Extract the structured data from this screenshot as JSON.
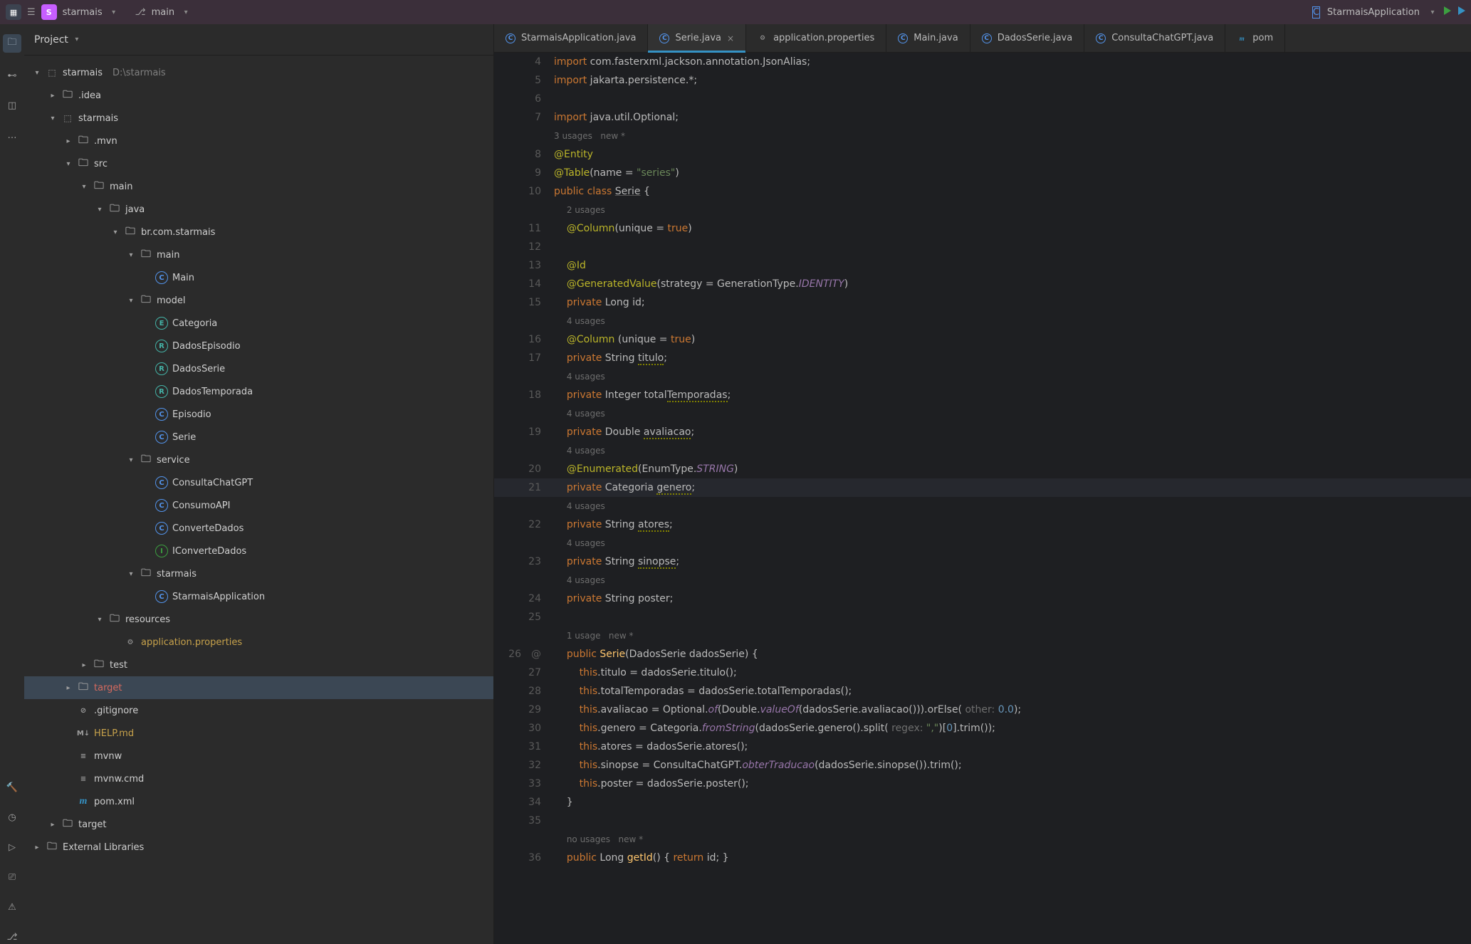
{
  "topbar": {
    "project_initial": "S",
    "project_name": "starmais",
    "branch": "main",
    "run_config": "StarmaisApplication"
  },
  "project_panel": {
    "title": "Project"
  },
  "tree": [
    {
      "d": 0,
      "c": "exp",
      "i": "mod",
      "l": "starmais",
      "suffix": "D:\\starmais"
    },
    {
      "d": 1,
      "c": "col",
      "i": "folder",
      "l": ".idea"
    },
    {
      "d": 1,
      "c": "exp",
      "i": "mod",
      "l": "starmais"
    },
    {
      "d": 2,
      "c": "col",
      "i": "folder",
      "l": ".mvn"
    },
    {
      "d": 2,
      "c": "exp",
      "i": "folder",
      "l": "src"
    },
    {
      "d": 3,
      "c": "exp",
      "i": "folder",
      "l": "main"
    },
    {
      "d": 4,
      "c": "exp",
      "i": "folder",
      "l": "java"
    },
    {
      "d": 5,
      "c": "exp",
      "i": "folder",
      "l": "br.com.starmais"
    },
    {
      "d": 6,
      "c": "exp",
      "i": "folder",
      "l": "main"
    },
    {
      "d": 7,
      "c": "none",
      "i": "c-blue",
      "ich": "C",
      "l": "Main"
    },
    {
      "d": 6,
      "c": "exp",
      "i": "folder",
      "l": "model"
    },
    {
      "d": 7,
      "c": "none",
      "i": "c-teal",
      "ich": "E",
      "l": "Categoria"
    },
    {
      "d": 7,
      "c": "none",
      "i": "c-teal",
      "ich": "R",
      "l": "DadosEpisodio"
    },
    {
      "d": 7,
      "c": "none",
      "i": "c-teal",
      "ich": "R",
      "l": "DadosSerie"
    },
    {
      "d": 7,
      "c": "none",
      "i": "c-teal",
      "ich": "R",
      "l": "DadosTemporada"
    },
    {
      "d": 7,
      "c": "none",
      "i": "c-blue",
      "ich": "C",
      "l": "Episodio"
    },
    {
      "d": 7,
      "c": "none",
      "i": "c-blue",
      "ich": "C",
      "l": "Serie"
    },
    {
      "d": 6,
      "c": "exp",
      "i": "folder",
      "l": "service"
    },
    {
      "d": 7,
      "c": "none",
      "i": "c-blue",
      "ich": "C",
      "l": "ConsultaChatGPT"
    },
    {
      "d": 7,
      "c": "none",
      "i": "c-blue",
      "ich": "C",
      "l": "ConsumoAPI"
    },
    {
      "d": 7,
      "c": "none",
      "i": "c-blue",
      "ich": "C",
      "l": "ConverteDados"
    },
    {
      "d": 7,
      "c": "none",
      "i": "c-green",
      "ich": "I",
      "l": "IConverteDados"
    },
    {
      "d": 6,
      "c": "exp",
      "i": "folder",
      "l": "starmais"
    },
    {
      "d": 7,
      "c": "none",
      "i": "c-blue",
      "ich": "C",
      "l": "StarmaisApplication"
    },
    {
      "d": 4,
      "c": "exp",
      "i": "folder",
      "l": "resources"
    },
    {
      "d": 5,
      "c": "none",
      "i": "plain",
      "ich": "⚙",
      "l": "application.properties",
      "cls": "yel"
    },
    {
      "d": 3,
      "c": "col",
      "i": "folder",
      "l": "test"
    },
    {
      "d": 2,
      "c": "col",
      "i": "folder",
      "l": "target",
      "cls": "red",
      "sel": true
    },
    {
      "d": 2,
      "c": "none",
      "i": "plain",
      "ich": "⊘",
      "l": ".gitignore"
    },
    {
      "d": 2,
      "c": "none",
      "i": "plain",
      "ich": "M↓",
      "l": "HELP.md",
      "cls": "yel"
    },
    {
      "d": 2,
      "c": "none",
      "i": "plain",
      "ich": "≡",
      "l": "mvnw"
    },
    {
      "d": 2,
      "c": "none",
      "i": "plain",
      "ich": "≡",
      "l": "mvnw.cmd"
    },
    {
      "d": 2,
      "c": "none",
      "i": "plain",
      "ich": "m",
      "l": "pom.xml",
      "icl": "m"
    },
    {
      "d": 1,
      "c": "col",
      "i": "folder",
      "l": "target"
    },
    {
      "d": 0,
      "c": "col",
      "i": "folder",
      "l": "External Libraries"
    }
  ],
  "tabs": [
    {
      "icon": "c",
      "label": "StarmaisApplication.java"
    },
    {
      "icon": "c",
      "label": "Serie.java",
      "active": true,
      "close": true
    },
    {
      "icon": "g",
      "label": "application.properties"
    },
    {
      "icon": "c",
      "label": "Main.java"
    },
    {
      "icon": "c",
      "label": "DadosSerie.java"
    },
    {
      "icon": "c",
      "label": "ConsultaChatGPT.java"
    },
    {
      "icon": "m",
      "label": "pom"
    }
  ],
  "code": [
    {
      "a": "",
      "b": "4",
      "h": "<span class='kw'>import</span> com.fasterxml.jackson.annotation.JsonAlias;"
    },
    {
      "a": "",
      "b": "5",
      "h": "<span class='kw'>import</span> jakarta.persistence.*;"
    },
    {
      "a": "",
      "b": "6",
      "h": ""
    },
    {
      "a": "",
      "b": "7",
      "h": "<span class='kw'>import</span> java.util.Optional;"
    },
    {
      "a": "",
      "b": "",
      "h": "<span class='com-hint'>3 usages   new *</span>"
    },
    {
      "a": "",
      "b": "8",
      "h": "<span class='ann'>@Entity</span>"
    },
    {
      "a": "",
      "b": "9",
      "h": "<span class='ann'>@Table</span>(name = <span class='str'>\"series\"</span>)"
    },
    {
      "a": "",
      "b": "10",
      "h": "<span class='kw'>public class</span> <span class='und'>Serie</span> {"
    },
    {
      "a": "",
      "b": "",
      "h": "    <span class='com-hint'>2 usages</span>"
    },
    {
      "a": "",
      "b": "11",
      "h": "    <span class='ann'>@Column</span>(unique = <span class='kw'>true</span>)"
    },
    {
      "a": "",
      "b": "12",
      "h": ""
    },
    {
      "a": "",
      "b": "13",
      "h": "    <span class='ann'>@Id</span>"
    },
    {
      "a": "",
      "b": "14",
      "h": "    <span class='ann'>@GeneratedValue</span>(strategy = GenerationType.<span class='fld'>IDENTITY</span>)"
    },
    {
      "a": "",
      "b": "15",
      "h": "    <span class='kw'>private</span> Long id;"
    },
    {
      "a": "",
      "b": "",
      "h": "    <span class='com-hint'>4 usages</span>"
    },
    {
      "a": "",
      "b": "16",
      "h": "    <span class='ann'>@Column</span> (unique = <span class='kw'>true</span>)"
    },
    {
      "a": "",
      "b": "17",
      "h": "    <span class='kw'>private</span> String <span class='und-warn'>titulo</span>;"
    },
    {
      "a": "",
      "b": "",
      "h": "    <span class='com-hint'>4 usages</span>"
    },
    {
      "a": "",
      "b": "18",
      "h": "    <span class='kw'>private</span> Integer total<span class='und-warn'>Temporadas</span>;"
    },
    {
      "a": "",
      "b": "",
      "h": "    <span class='com-hint'>4 usages</span>"
    },
    {
      "a": "",
      "b": "19",
      "h": "    <span class='kw'>private</span> Double <span class='und-warn'>avaliacao</span>;"
    },
    {
      "a": "",
      "b": "",
      "h": "    <span class='com-hint'>4 usages</span>"
    },
    {
      "a": "",
      "b": "20",
      "h": "    <span class='ann'>@Enumerated</span>(EnumType.<span class='fld'>STRING</span>)"
    },
    {
      "a": "",
      "b": "21",
      "hl": true,
      "h": "    <span class='kw'>private</span> Categoria <span class='und-warn'>genero</span>;"
    },
    {
      "a": "",
      "b": "",
      "h": "    <span class='com-hint'>4 usages</span>"
    },
    {
      "a": "",
      "b": "22",
      "h": "    <span class='kw'>private</span> String <span class='und-warn'>atores</span>;"
    },
    {
      "a": "",
      "b": "",
      "h": "    <span class='com-hint'>4 usages</span>"
    },
    {
      "a": "",
      "b": "23",
      "h": "    <span class='kw'>private</span> String <span class='und-warn'>sinopse</span>;"
    },
    {
      "a": "",
      "b": "",
      "h": "    <span class='com-hint'>4 usages</span>"
    },
    {
      "a": "",
      "b": "24",
      "h": "    <span class='kw'>private</span> String poster;"
    },
    {
      "a": "",
      "b": "25",
      "h": ""
    },
    {
      "a": "",
      "b": "",
      "h": "    <span class='com-hint'>1 usage   new *</span>"
    },
    {
      "a": "26",
      "b": "@",
      "h": "    <span class='kw'>public</span> <span class='mth'>Serie</span>(DadosSerie dadosSerie) {"
    },
    {
      "a": "",
      "b": "27",
      "h": "        <span class='kw'>this</span>.titulo = dadosSerie.titulo();"
    },
    {
      "a": "",
      "b": "28",
      "h": "        <span class='kw'>this</span>.totalTemporadas = dadosSerie.totalTemporadas();"
    },
    {
      "a": "",
      "b": "29",
      "h": "        <span class='kw'>this</span>.avaliacao = Optional.<span class='fld'>of</span>(Double.<span class='fld'>valueOf</span>(dadosSerie.avaliacao())).orElse( <span class='param'>other:</span> <span class='num'>0.0</span>);"
    },
    {
      "a": "",
      "b": "30",
      "h": "        <span class='kw'>this</span>.genero = Categoria.<span class='fld'>fromString</span>(dadosSerie.genero().split( <span class='param'>regex:</span> <span class='str'>\",\"</span>)[<span class='num'>0</span>].trim());"
    },
    {
      "a": "",
      "b": "31",
      "h": "        <span class='kw'>this</span>.atores = dadosSerie.atores();"
    },
    {
      "a": "",
      "b": "32",
      "h": "        <span class='kw'>this</span>.sinopse = ConsultaChatGPT.<span class='fld'>obterTraducao</span>(dadosSerie.sinopse()).trim();"
    },
    {
      "a": "",
      "b": "33",
      "h": "        <span class='kw'>this</span>.poster = dadosSerie.poster();"
    },
    {
      "a": "",
      "b": "34",
      "h": "    }"
    },
    {
      "a": "",
      "b": "35",
      "h": ""
    },
    {
      "a": "",
      "b": "",
      "h": "    <span class='com-hint'>no usages   new *</span>"
    },
    {
      "a": "",
      "b": "36",
      "h": "    <span class='kw'>public</span> Long <span class='mth'>getId</span>() { <span class='kw'>return</span> id; }"
    }
  ]
}
